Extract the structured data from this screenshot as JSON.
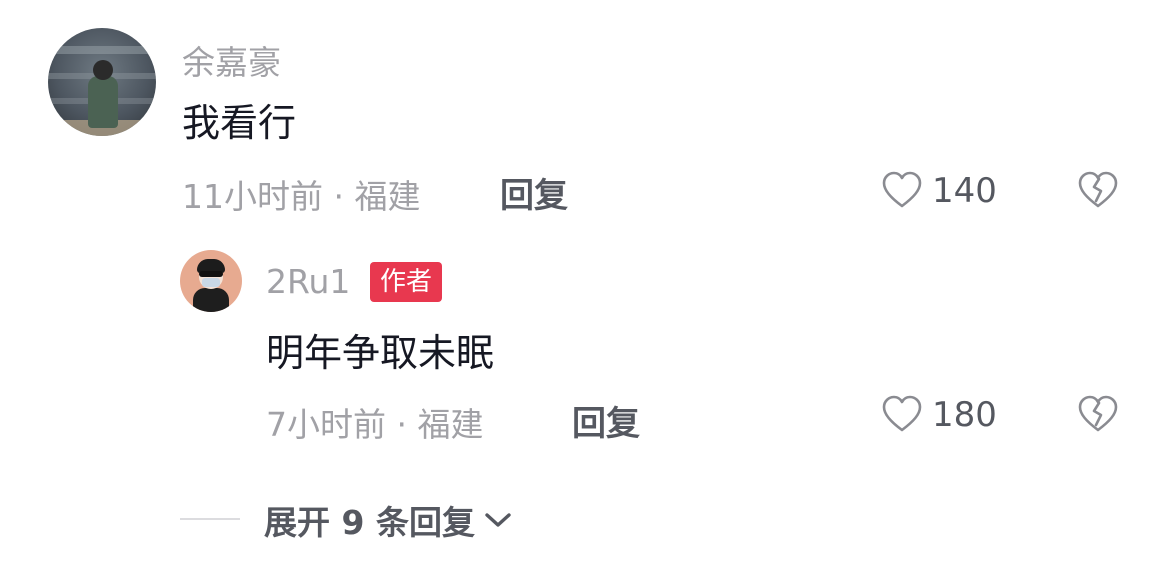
{
  "comment": {
    "username": "余嘉豪",
    "text": "我看行",
    "time": "11小时前",
    "separator": "·",
    "location": "福建",
    "reply_label": "回复",
    "like_count": "140"
  },
  "reply": {
    "username": "2Ru1",
    "badge": "作者",
    "text": "明年争取未眠",
    "time": "7小时前",
    "separator": "·",
    "location": "福建",
    "reply_label": "回复",
    "like_count": "180"
  },
  "expand": {
    "label": "展开 9 条回复"
  },
  "icons": {
    "like": "heart-outline-icon",
    "dislike": "broken-heart-icon",
    "expand": "chevron-down-icon"
  },
  "colors": {
    "badge": "#e8384f",
    "meta_text": "#a1a1a6",
    "primary_text": "#161823"
  }
}
